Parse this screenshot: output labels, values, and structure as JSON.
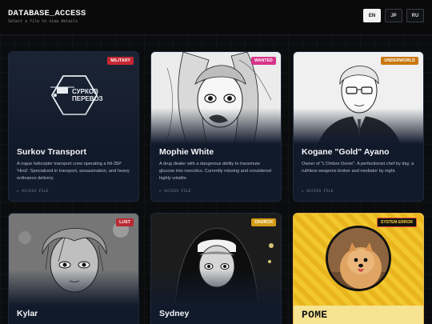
{
  "header": {
    "title": "DATABASE_ACCESS",
    "subtitle": "Select a file to view details",
    "languages": [
      "EN",
      "JP",
      "RU"
    ],
    "active_language": "EN"
  },
  "access_label": "▸ ACCESS FILE",
  "cards": [
    {
      "name": "Surkov Transport",
      "badge": "MILITARY",
      "badge_color": "#c52733",
      "logo_line1": "СУРКОВ",
      "logo_line2": "ПЕРЕВОЗ",
      "description": "A rogue helicopter transport crew operating a Mi-35P 'Hind'. Specialized in transport, assassination, and heavy ordinance delivery."
    },
    {
      "name": "Mophie White",
      "badge": "WANTED",
      "badge_color": "#d8338a",
      "description": "A drug dealer with a dangerous ability to transmute glucose into narcotics. Currently missing and considered highly volatile."
    },
    {
      "name": "Kogane \"Gold\" Ayano",
      "badge": "UNDERWORLD",
      "badge_color": "#c8780f",
      "description": "Owner of \"L'Ombre Dorée\". A perfectionist chef by day, a ruthless weapons broker and mediator by night."
    },
    {
      "name": "Kylar",
      "badge": "LUST",
      "badge_color": "#b82a33"
    },
    {
      "name": "Sydney",
      "badge": "CHURCH",
      "badge_color": "#d39c16"
    },
    {
      "name": "POME",
      "badge": "SYSTEM ERROR",
      "badge_color": "#111111"
    }
  ]
}
